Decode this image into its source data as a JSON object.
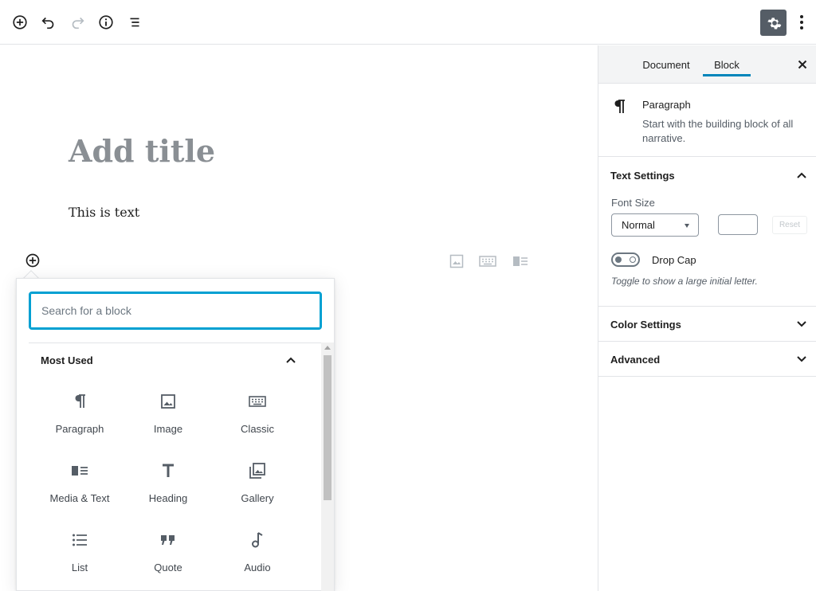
{
  "toolbar": {
    "add_block_icon": "plus-circle-icon",
    "undo_icon": "undo-icon",
    "redo_icon": "redo-icon",
    "info_icon": "info-icon",
    "outline_icon": "list-view-icon",
    "settings_icon": "gear-icon",
    "more_icon": "more-vertical-icon"
  },
  "editor": {
    "title_placeholder": "Add title",
    "paragraph_text": "This is text"
  },
  "inserter": {
    "search_placeholder": "Search for a block",
    "section_title": "Most Used",
    "blocks": [
      {
        "label": "Paragraph",
        "icon": "paragraph-icon"
      },
      {
        "label": "Image",
        "icon": "image-icon"
      },
      {
        "label": "Classic",
        "icon": "keyboard-icon"
      },
      {
        "label": "Media & Text",
        "icon": "media-text-icon"
      },
      {
        "label": "Heading",
        "icon": "heading-icon"
      },
      {
        "label": "Gallery",
        "icon": "gallery-icon"
      },
      {
        "label": "List",
        "icon": "list-icon"
      },
      {
        "label": "Quote",
        "icon": "quote-icon"
      },
      {
        "label": "Audio",
        "icon": "audio-icon"
      }
    ]
  },
  "sidebar": {
    "tabs": [
      "Document",
      "Block"
    ],
    "active_tab": "Block",
    "block_card": {
      "title": "Paragraph",
      "description": "Start with the building block of all narrative."
    },
    "text_settings": {
      "title": "Text Settings",
      "font_size_label": "Font Size",
      "font_size_value": "Normal",
      "reset_label": "Reset",
      "drop_cap_label": "Drop Cap",
      "drop_cap_help": "Toggle to show a large initial letter."
    },
    "color_settings": {
      "title": "Color Settings"
    },
    "advanced": {
      "title": "Advanced"
    }
  },
  "colors": {
    "accent": "#0085ba",
    "focus": "#00a0d2",
    "settings_button_bg": "#555d66"
  }
}
